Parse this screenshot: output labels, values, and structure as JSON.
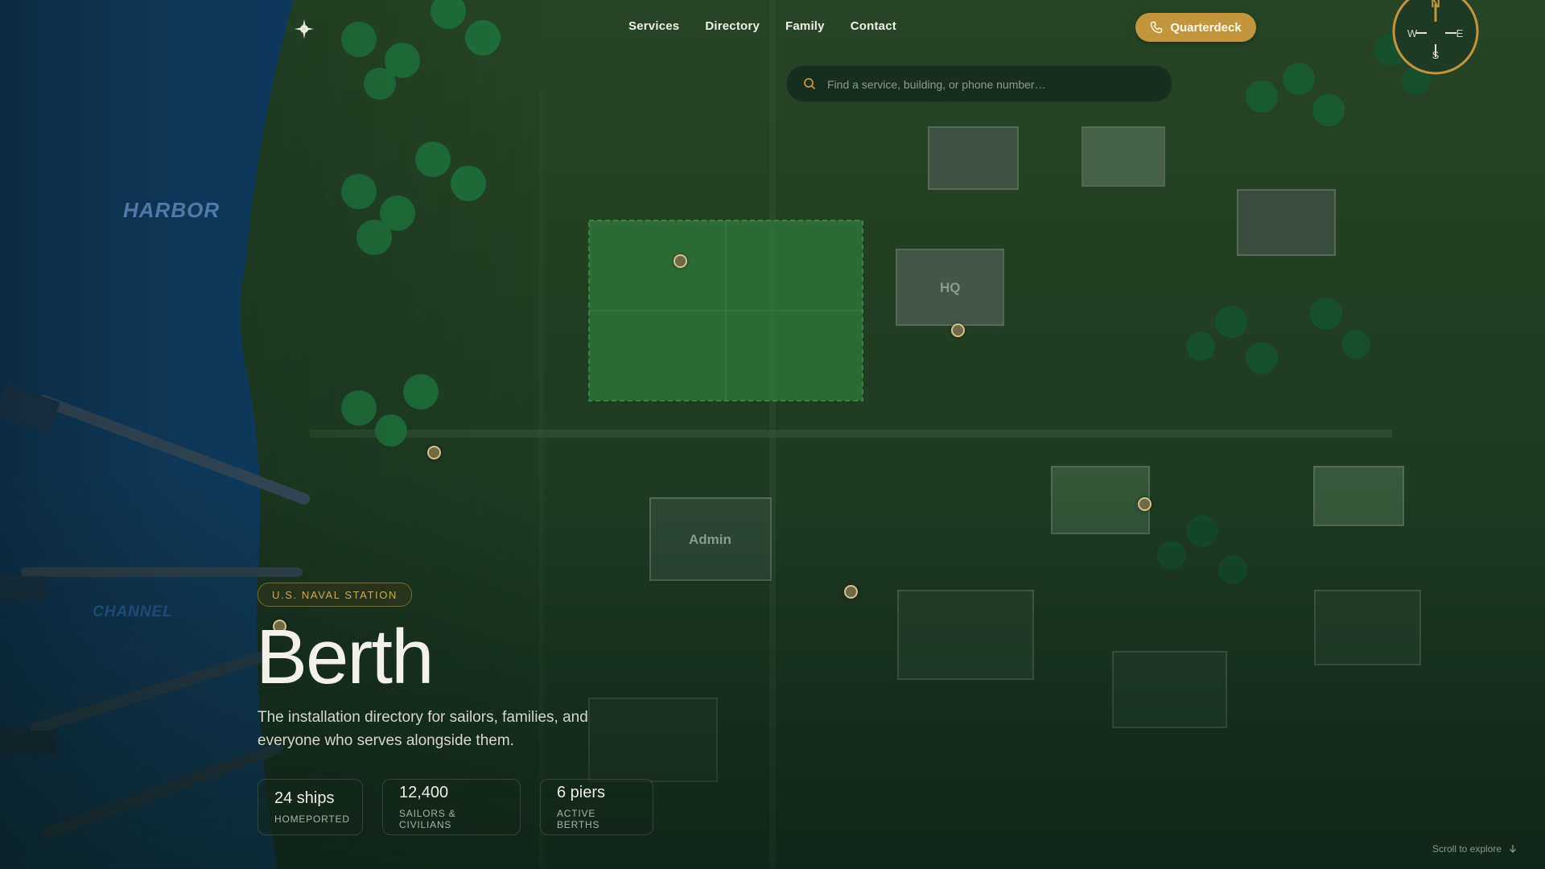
{
  "nav": {
    "links": [
      "Services",
      "Directory",
      "Family",
      "Contact"
    ],
    "cta_label": "Quarterdeck"
  },
  "compass": {
    "n": "N",
    "s": "S",
    "e": "E",
    "w": "W"
  },
  "search": {
    "placeholder": "Find a service, building, or phone number…"
  },
  "map": {
    "labels": {
      "harbor": "HARBOR",
      "channel": "CHANNEL"
    },
    "buildings": {
      "hq": "HQ",
      "admin": "Admin"
    }
  },
  "hero": {
    "eyebrow": "U.S. NAVAL STATION",
    "title": "Berth",
    "subtitle": "The installation directory for sailors, families, and everyone who serves alongside them.",
    "stats": [
      {
        "value": "24 ships",
        "label": "HOMEPORTED"
      },
      {
        "value": "12,400",
        "label": "SAILORS & CIVILIANS"
      },
      {
        "value": "6 piers",
        "label": "ACTIVE BERTHS"
      }
    ]
  },
  "scroll_hint": "Scroll to explore",
  "colors": {
    "accent": "#c2963f",
    "water": "#0f3f6b",
    "land": "#1f3b22"
  }
}
